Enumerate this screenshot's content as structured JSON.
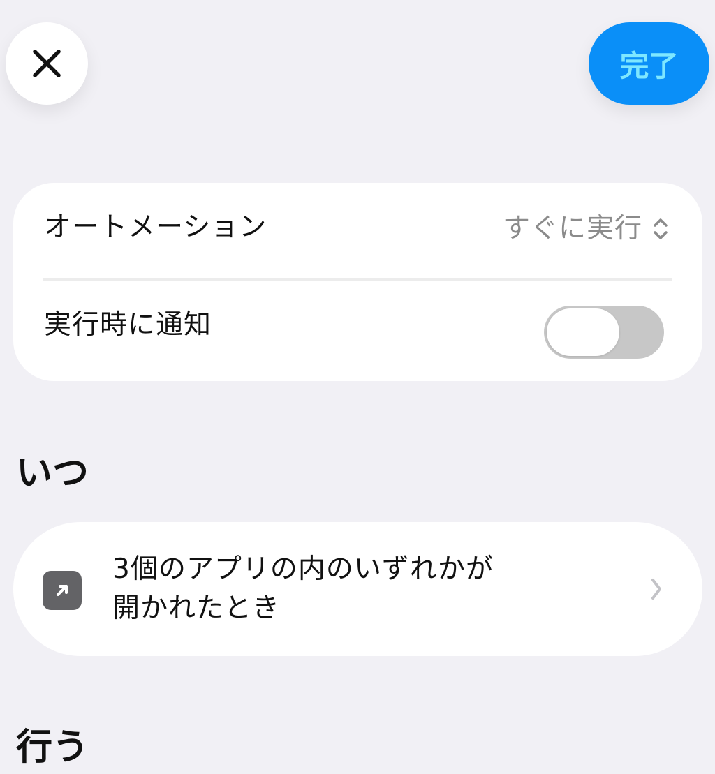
{
  "header": {
    "close_icon": "close-icon",
    "done_label": "完了"
  },
  "settings": {
    "automation_label": "オートメーション",
    "automation_value": "すぐに実行",
    "automation_value_icon": "chevron-up-down-icon",
    "notify_label": "実行時に通知",
    "notify_enabled": false
  },
  "sections": {
    "when_title": "いつ",
    "do_title": "行う"
  },
  "trigger": {
    "icon": "arrow-up-right-icon",
    "line1": "3個のアプリの内のいずれかが",
    "line2": "開かれたとき",
    "chevron_icon": "chevron-right-icon"
  },
  "colors": {
    "background": "#f1f0f5",
    "card": "#ffffff",
    "accent": "#0a8ff8",
    "accent_text": "#7ee7ff",
    "secondary_text": "#8b8b8b",
    "toggle_off": "#c7c7c7",
    "icon_tile": "#636366"
  }
}
